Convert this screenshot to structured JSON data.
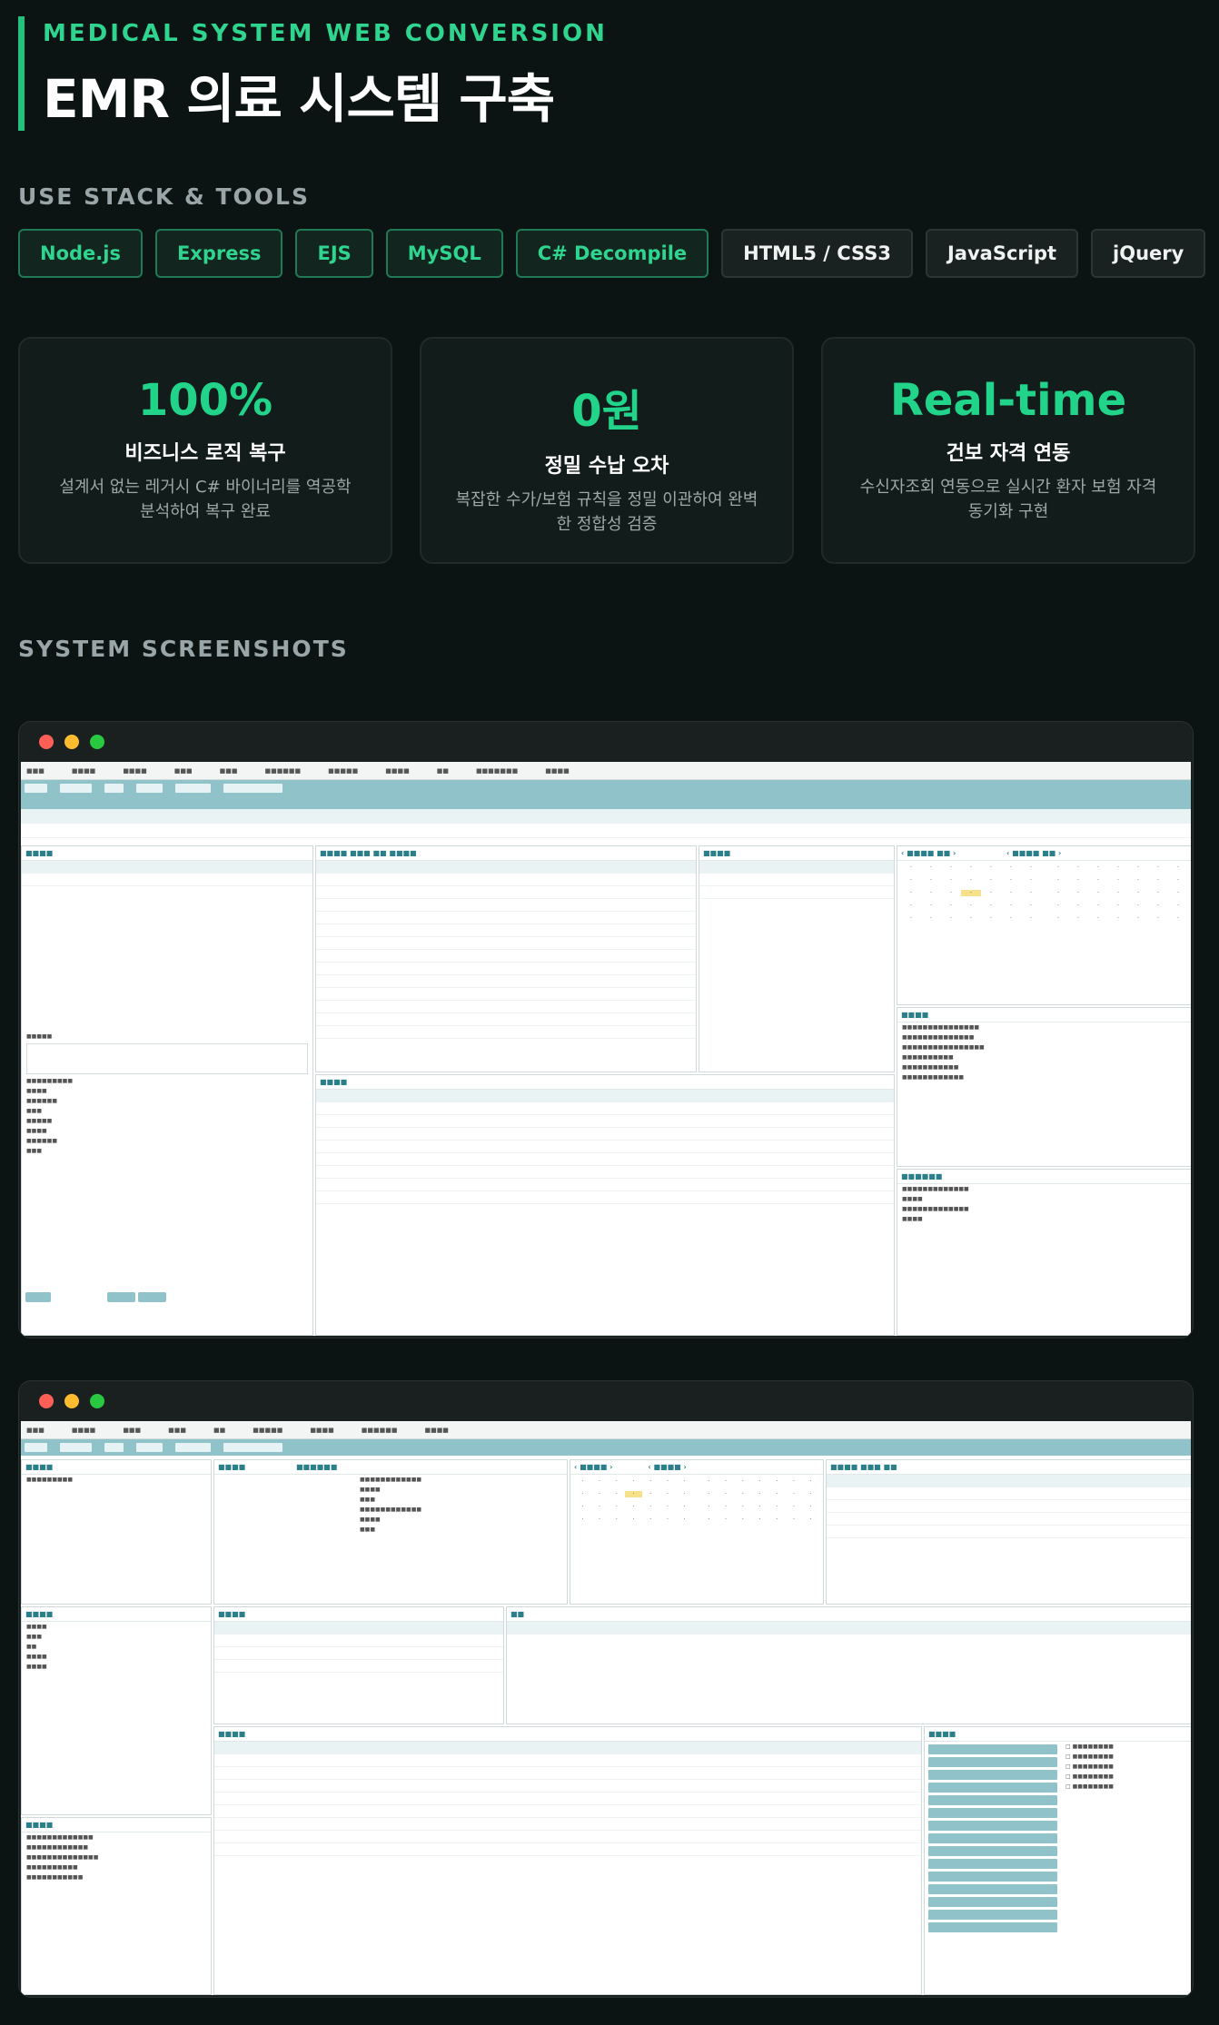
{
  "header": {
    "eyebrow": "MEDICAL SYSTEM WEB CONVERSION",
    "title": "EMR 의료 시스템 구축"
  },
  "stack": {
    "label": "USE STACK & TOOLS",
    "items": [
      {
        "label": "Node.js",
        "style": "green"
      },
      {
        "label": "Express",
        "style": "green"
      },
      {
        "label": "EJS",
        "style": "green"
      },
      {
        "label": "MySQL",
        "style": "green"
      },
      {
        "label": "C# Decompile",
        "style": "green"
      },
      {
        "label": "HTML5 / CSS3",
        "style": "gray"
      },
      {
        "label": "JavaScript",
        "style": "gray"
      },
      {
        "label": "jQuery",
        "style": "gray"
      }
    ]
  },
  "stats": [
    {
      "num": "100%",
      "head": "비즈니스 로직 복구",
      "desc": "설계서 없는 레거시 C# 바이너리를 역공학 분석하여 복구 완료"
    },
    {
      "num": "0원",
      "head": "정밀 수납 오차",
      "desc": "복잡한 수가/보험 규칙을 정밀 이관하여 완벽한 정합성 검증"
    },
    {
      "num": "Real-time",
      "head": "건보 자격 연동",
      "desc": "수신자조회 연동으로 실시간 환자 보험 자격 동기화 구현"
    }
  ],
  "screenshots": {
    "label": "SYSTEM SCREENSHOTS"
  },
  "colors": {
    "accent": "#2fd58e",
    "background": "#0b1413",
    "app_teal": "#8fc2c9"
  }
}
